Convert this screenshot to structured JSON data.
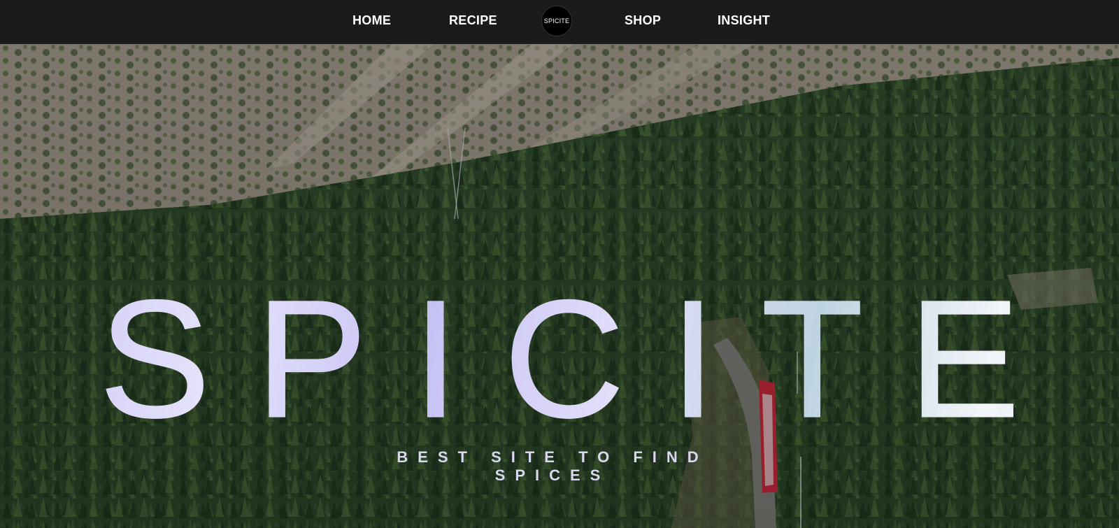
{
  "nav": {
    "home": "HOME",
    "recipe": "RECIPE",
    "logo": "SPICITE",
    "shop": "SHOP",
    "insight": "INSIGHT"
  },
  "hero": {
    "title": "SPICITE",
    "tagline": "BEST SITE TO FIND SPICES",
    "background": "aerial-forest-mountain-railway"
  },
  "colors": {
    "nav_background": "#1b1b1a",
    "nav_text": "#ffffff",
    "title_fill": "#c9c6ef",
    "forest": "#2e4a2c",
    "rail": "#c8283a"
  }
}
